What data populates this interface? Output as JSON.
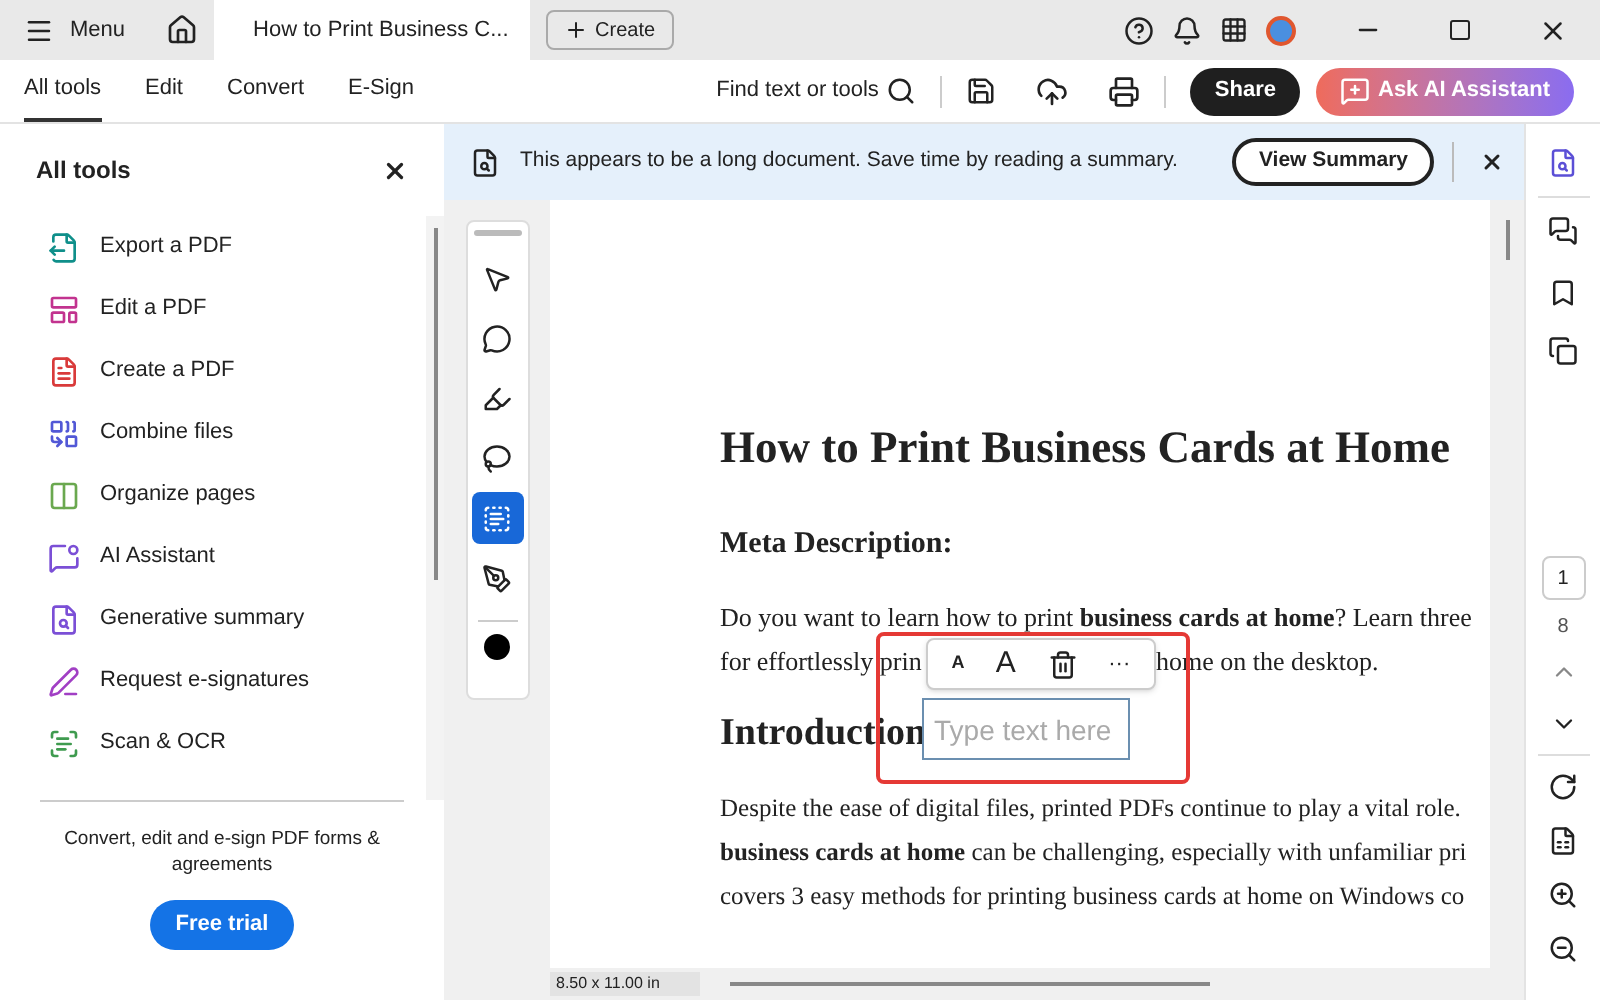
{
  "title_bar": {
    "menu": "Menu",
    "tabs": [
      {
        "title": "How to Print Business C...",
        "selected": true
      }
    ],
    "create": "Create"
  },
  "toolbar": {
    "tabs": [
      {
        "label": "All tools",
        "selected": true
      },
      {
        "label": "Edit",
        "selected": false
      },
      {
        "label": "Convert",
        "selected": false
      },
      {
        "label": "E-Sign",
        "selected": false
      }
    ],
    "search": "Find text or tools",
    "share": "Share",
    "ai": "Ask AI Assistant"
  },
  "banner": {
    "text": "This appears to be a long document. Save time by reading a summary.",
    "button": "View Summary"
  },
  "tools_panel": {
    "title": "All tools",
    "items": [
      {
        "label": "Export a PDF",
        "color": "#0f8f8a"
      },
      {
        "label": "Edit a PDF",
        "color": "#c2338f"
      },
      {
        "label": "Create a PDF",
        "color": "#d93a3a"
      },
      {
        "label": "Combine files",
        "color": "#5258d6"
      },
      {
        "label": "Organize pages",
        "color": "#6aa84f"
      },
      {
        "label": "AI Assistant",
        "color": "#7b4fd6"
      },
      {
        "label": "Generative summary",
        "color": "#7b4fd6"
      },
      {
        "label": "Request e-signatures",
        "color": "#a13fc4"
      },
      {
        "label": "Scan & OCR",
        "color": "#3f9b4f"
      }
    ],
    "promo": "Convert, edit and e-sign PDF forms & agreements",
    "trial": "Free trial"
  },
  "tool_rail": [
    {
      "selected": false
    },
    {
      "selected": false
    },
    {
      "selected": false
    },
    {
      "selected": false
    },
    {
      "selected": true
    },
    {
      "selected": false
    }
  ],
  "document": {
    "title": "How to Print Business Cards at Home",
    "meta_heading": "Meta Description:",
    "para1_line1": "Do you want to learn how to print **business cards at home**? Learn three",
    "para1_line2_left": "for effortlessly prin",
    "para1_line2_right": "home on the desktop.",
    "intro_heading": "Introduction",
    "para2_lines": [
      "Despite the ease of digital files, printed PDFs continue to play a vital role.",
      "**business cards at home** can be challenging, especially with unfamiliar pri",
      "covers 3 easy methods for printing business cards at home on Windows co"
    ]
  },
  "text_popup": {
    "smaller": "A",
    "larger": "A",
    "more": "···",
    "placeholder": "Type text here"
  },
  "status": {
    "page_size": "8.50 x 11.00 in"
  },
  "page_nav": {
    "current": "1",
    "total": "8"
  }
}
